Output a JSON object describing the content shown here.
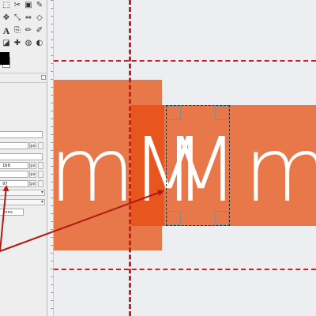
{
  "colors": {
    "text_block": "#e8784a",
    "selected_block": "#e9551e",
    "guide": "#c62020",
    "arrow": "#b01a12",
    "canvas_bg": "#eceef2"
  },
  "toolbox": {
    "tools": [
      {
        "icon": "rect-select-icon",
        "glyph": "⬚"
      },
      {
        "icon": "scissors-icon",
        "glyph": "✂"
      },
      {
        "icon": "paint-bucket-icon",
        "glyph": "▣"
      },
      {
        "icon": "color-picker-icon",
        "glyph": "✎"
      },
      {
        "icon": "move-icon",
        "glyph": "✥"
      },
      {
        "icon": "scale-icon",
        "glyph": "⤡"
      },
      {
        "icon": "flip-icon",
        "glyph": "⇔"
      },
      {
        "icon": "cage-icon",
        "glyph": "◇"
      },
      {
        "icon": "text-tool-icon",
        "glyph": "A"
      },
      {
        "icon": "clone-icon",
        "glyph": "⎘"
      },
      {
        "icon": "pencil-icon",
        "glyph": "✏"
      },
      {
        "icon": "brush-icon",
        "glyph": "✐"
      },
      {
        "icon": "eraser-icon",
        "glyph": "◪"
      },
      {
        "icon": "heal-icon",
        "glyph": "✚"
      },
      {
        "icon": "smudge-icon",
        "glyph": "◍"
      },
      {
        "icon": "dodge-icon",
        "glyph": "◐"
      }
    ]
  },
  "tool_options": {
    "field_1": "",
    "unit_1": "px",
    "field_2": "",
    "unit_2": "px",
    "field_3": "168",
    "unit_3": "px",
    "field_4": "",
    "unit_4": "px",
    "field_5": "97",
    "unit_5": "px",
    "field_6": "ions"
  },
  "canvas": {
    "left_glyphs": "mM",
    "right_glyphs": "Mm"
  }
}
